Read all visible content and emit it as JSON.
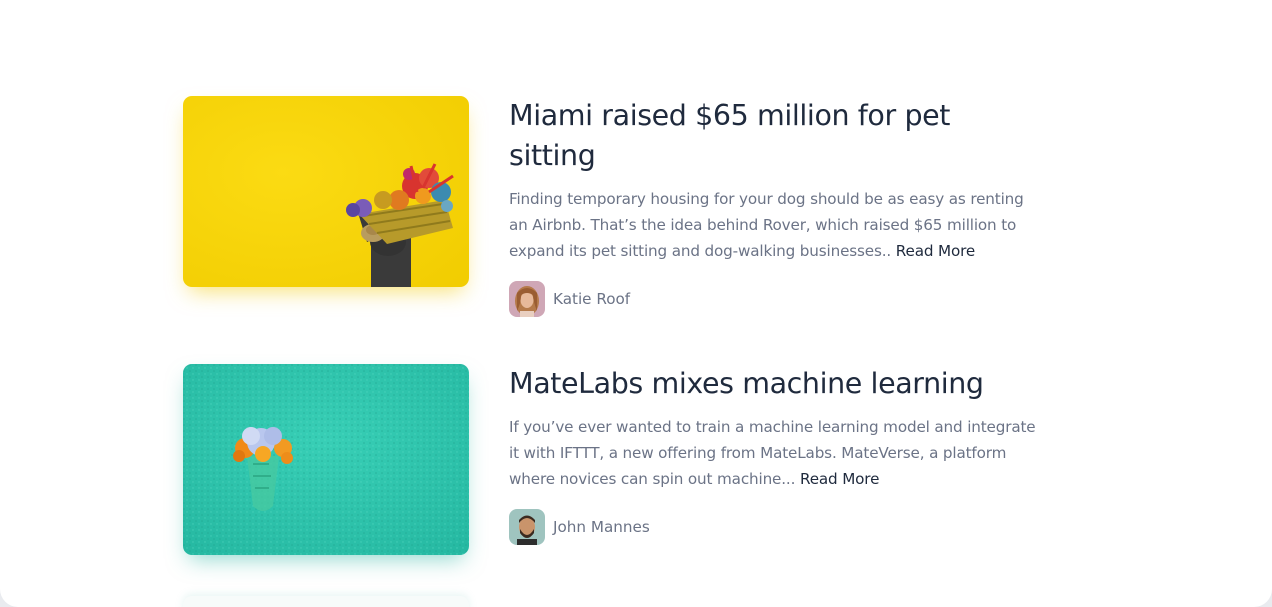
{
  "articles": [
    {
      "title": "Miami raised $65 million for pet sitting",
      "excerpt": "Finding temporary housing for your dog should be as easy as renting an Airbnb. That’s the idea behind Rover, which raised $65 million to expand its pet sitting and dog-walking businesses..",
      "read_more": "Read More",
      "author": "Katie Roof",
      "image_icon": "flower-basket-photo",
      "accent": "#f7d300"
    },
    {
      "title": "MateLabs mixes machine learning",
      "excerpt": "If you’ve ever wanted to train a machine learning model and integrate it with IFTTT, a new offering from MateLabs. MateVerse, a platform where novices can spin out machine...",
      "read_more": "Read More",
      "author": "John Mannes",
      "image_icon": "flower-vase-photo",
      "accent": "#2fc4ae"
    }
  ],
  "colors": {
    "title": "#1f2a3d",
    "body": "#6b7386",
    "background": "#ffffff"
  }
}
